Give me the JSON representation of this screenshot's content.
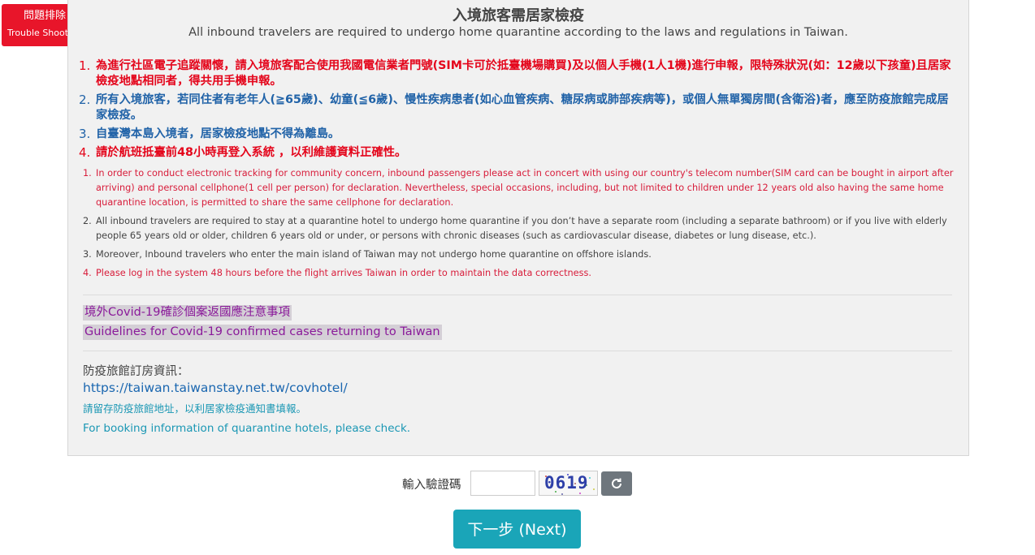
{
  "trouble": {
    "zh": "問題排除",
    "en": "Trouble Shooting"
  },
  "header": {
    "title_zh": "入境旅客需居家檢疫",
    "title_en": "All inbound travelers are required to undergo home quarantine according to the laws and regulations in Taiwan."
  },
  "notices_zh": [
    {
      "num": "1.",
      "text": "為進行社區電子追蹤關懷，請入境旅客配合使用我國電信業者門號(SIM卡可於抵臺機場購買)及以個人手機(1人1機)進行申報，限特殊狀況(如：12歲以下孩童)且居家檢疫地點相同者，得共用手機申報。"
    },
    {
      "num": "2.",
      "text": "所有入境旅客，若同住者有老年人(≧65歲)、幼童(≦6歲)、慢性疾病患者(如心血管疾病、糖尿病或肺部疾病等)，或個人無單獨房間(含衛浴)者，應至防疫旅館完成居家檢疫。"
    },
    {
      "num": "3.",
      "text": "自臺灣本島入境者，居家檢疫地點不得為離島。"
    },
    {
      "num": "4.",
      "text": "請於航班抵臺前48小時再登入系統 ，以利維護資料正確性。"
    }
  ],
  "notices_en": [
    {
      "num": "1.",
      "text": "In order to conduct electronic tracking for community concern, inbound passengers please act in concert with using our country's telecom number(SIM card can be bought in airport after arriving) and personal cellphone(1 cell per person) for declaration. Nevertheless, special occasions, including, but not limited to children under 12 years old also having the same home quarantine location, is permitted to share the same cellphone for declaration."
    },
    {
      "num": "2.",
      "text": "All inbound travelers are required to stay at a quarantine hotel to undergo home quarantine if you don’t have a separate room (including a separate bathroom) or if you live with elderly people 65 years old or older, children 6 years old or under, or persons with chronic diseases (such as cardiovascular disease, diabetes or lung disease, etc.)."
    },
    {
      "num": "3.",
      "text": "Moreover, Inbound travelers who enter the main island of Taiwan may not undergo home quarantine on offshore islands."
    },
    {
      "num": "4.",
      "text": "Please log in the system 48 hours before the flight arrives Taiwan in order to maintain the data correctness."
    }
  ],
  "guidelines": {
    "zh": "境外Covid-19確診個案返國應注意事項",
    "en": "Guidelines for Covid-19 confirmed cases returning to Taiwan"
  },
  "hotel": {
    "title": "防疫旅館訂房資訊：",
    "link": "https://taiwan.taiwanstay.net.tw/covhotel/",
    "note_zh": "請留存防疫旅館地址，以利居家檢疫通知書填報。",
    "note_en": "For booking information of quarantine hotels, please check."
  },
  "captcha": {
    "label": "輸入驗證碼",
    "code": "0619",
    "value": ""
  },
  "next_label": "下一步 (Next)",
  "colors": {
    "red": "#e4051b",
    "blue": "#2163a8",
    "teal": "#1aa5b8",
    "purple": "#8a1a9a",
    "trouble": "#e8152a"
  }
}
